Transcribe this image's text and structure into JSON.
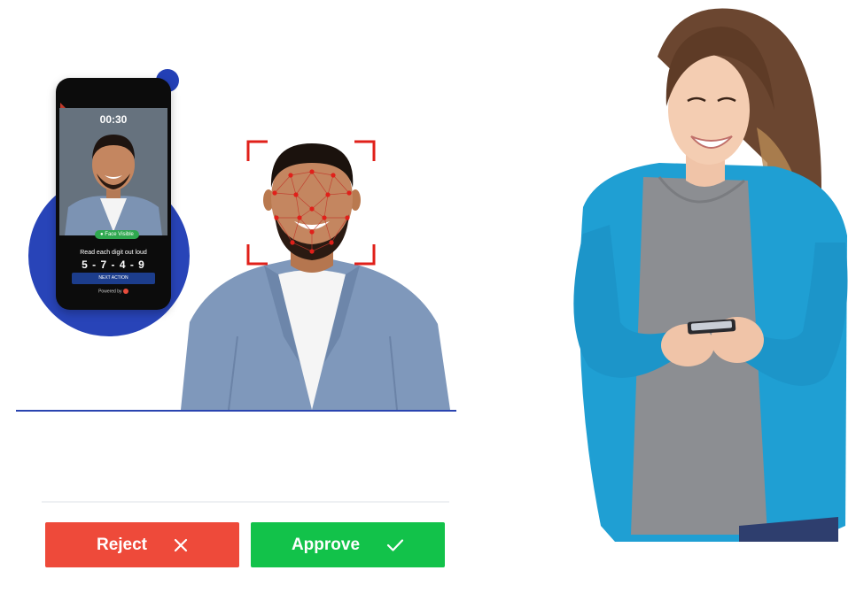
{
  "phone": {
    "timer": "00:30",
    "face_chip": "Face Visible",
    "instruction": "Read each digit out loud",
    "digits": "5 - 7 - 4 - 9",
    "button_label": "NEXT ACTION",
    "powered_by": "Powered by"
  },
  "actions": {
    "reject_label": "Reject",
    "reject_icon": "close-icon",
    "approve_label": "Approve",
    "approve_icon": "check-icon"
  },
  "colors": {
    "reject": "#ee4a3a",
    "approve": "#12c24a",
    "accent_blue": "#2844b8",
    "landmark_red": "#e0201a"
  }
}
